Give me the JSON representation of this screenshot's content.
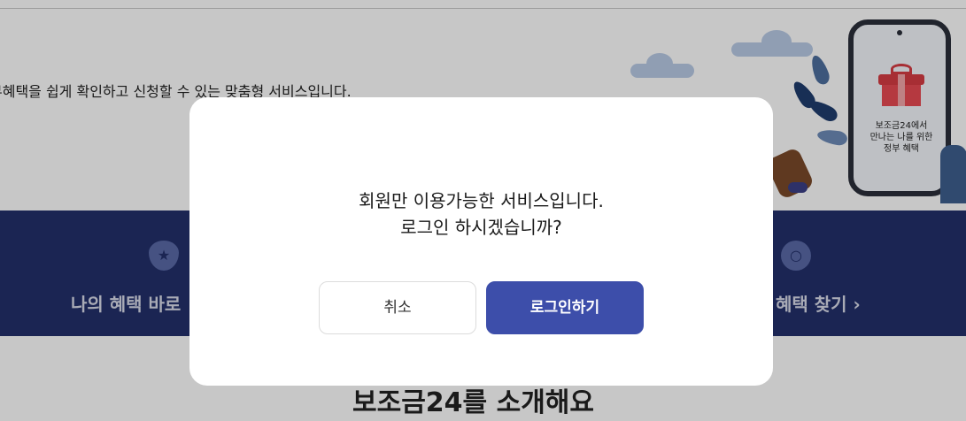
{
  "hero": {
    "description": "부혜택을 쉽게 확인하고 신청할 수 있는 맞춤형 서비스입니다.",
    "phone_text": [
      "보조금24에서",
      "만나는 나를 위한",
      "정부 혜택"
    ]
  },
  "banner": {
    "left_link": "나의 혜택 바로",
    "right_link": "혜택 찾기 ›",
    "background_color": "#23306b"
  },
  "section": {
    "title": "보조금24를 소개해요"
  },
  "modal": {
    "message_line1": "회원만 이용가능한 서비스입니다.",
    "message_line2": "로그인 하시겠습니까?",
    "cancel_label": "취소",
    "login_label": "로그인하기",
    "primary_color": "#3d4eaa"
  },
  "icons": {
    "banner_left": "bookmark-star-icon",
    "banner_right": "search-icon"
  }
}
